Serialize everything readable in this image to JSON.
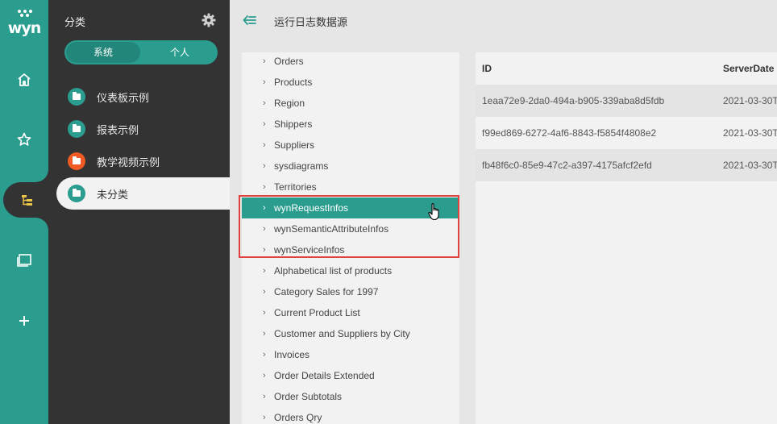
{
  "rail": {
    "logo": "wyn",
    "items": [
      {
        "icon": "home-icon"
      },
      {
        "icon": "star-icon"
      },
      {
        "icon": "category-tree-icon"
      },
      {
        "icon": "documents-icon"
      },
      {
        "icon": "plus-icon"
      }
    ],
    "active_index": 2
  },
  "category_panel": {
    "title": "分类",
    "toggle": {
      "system": "系统",
      "personal": "个人",
      "selected": "system"
    },
    "items": [
      {
        "label": "仪表板示例",
        "color": "#2a9d8f"
      },
      {
        "label": "报表示例",
        "color": "#2a9d8f"
      },
      {
        "label": "教学视频示例",
        "color": "#f15a24"
      },
      {
        "label": "未分类",
        "color": "#2a9d8f",
        "active": true
      }
    ]
  },
  "header": {
    "title": "运行日志数据源"
  },
  "tables": {
    "items": [
      "Orders",
      "Products",
      "Region",
      "Shippers",
      "Suppliers",
      "sysdiagrams",
      "Territories",
      "wynRequestInfos",
      "wynSemanticAttributeInfos",
      "wynServiceInfos",
      "Alphabetical list of products",
      "Category Sales for 1997",
      "Current Product List",
      "Customer and Suppliers by City",
      "Invoices",
      "Order Details Extended",
      "Order Subtotals",
      "Orders Qry"
    ],
    "selected": "wynRequestInfos"
  },
  "grid": {
    "columns": [
      "ID",
      "ServerDate"
    ],
    "rows": [
      [
        "1eaa72e9-2da0-494a-b905-339aba8d5fdb",
        "2021-03-30T"
      ],
      [
        "f99ed869-6272-4af6-8843-f5854f4808e2",
        "2021-03-30T"
      ],
      [
        "fb48f6c0-85e9-47c2-a397-4175afcf2efd",
        "2021-03-30T"
      ]
    ]
  },
  "colors": {
    "accent": "#2a9d8f",
    "highlight": "#e0433f",
    "panel_dark": "#333333"
  }
}
